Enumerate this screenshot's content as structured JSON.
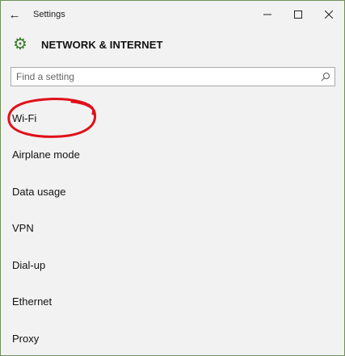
{
  "window": {
    "title": "Settings"
  },
  "header": {
    "title": "NETWORK & INTERNET"
  },
  "search": {
    "placeholder": "Find a setting"
  },
  "nav": {
    "items": [
      {
        "label": "Wi-Fi"
      },
      {
        "label": "Airplane mode"
      },
      {
        "label": "Data usage"
      },
      {
        "label": "VPN"
      },
      {
        "label": "Dial-up"
      },
      {
        "label": "Ethernet"
      },
      {
        "label": "Proxy"
      }
    ]
  },
  "annotation": {
    "color": "#e0101a"
  },
  "accent": "#3a7a2a"
}
